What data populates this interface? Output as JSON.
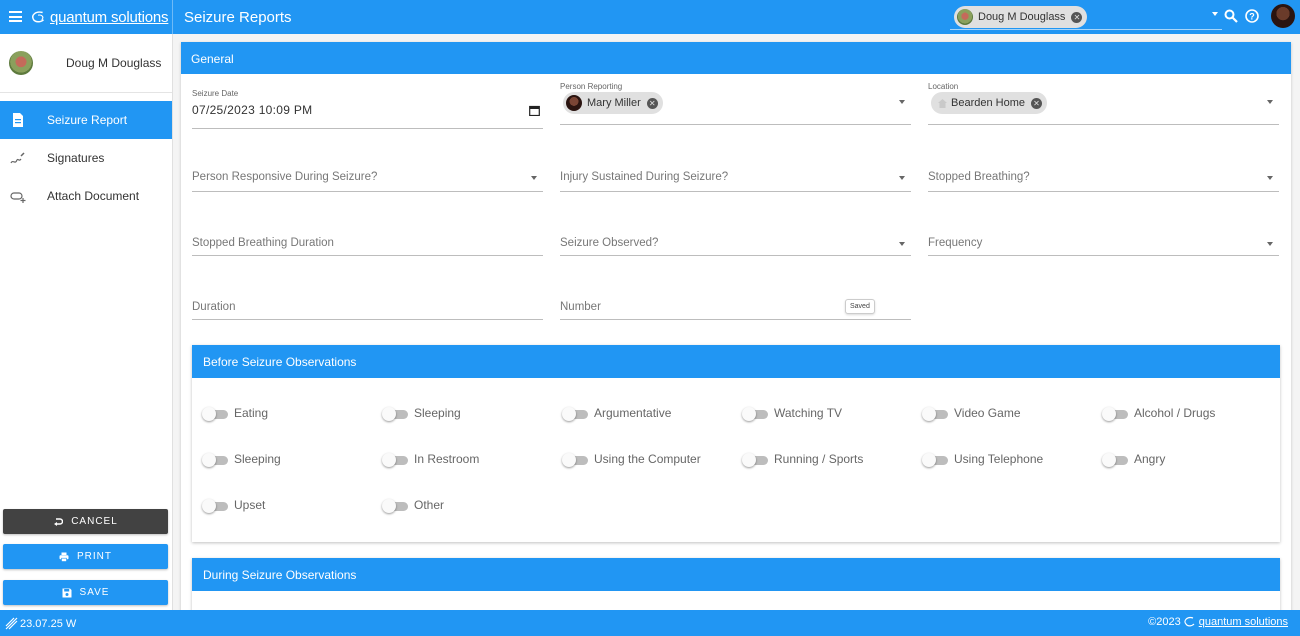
{
  "app": {
    "brand": "quantum solutions",
    "title": "Seizure Reports"
  },
  "header": {
    "selected_user": "Doug M Douglass"
  },
  "sidebar": {
    "user_name": "Doug M Douglass",
    "items": [
      {
        "label": "Seizure Report",
        "icon": "document-icon",
        "active": true
      },
      {
        "label": "Signatures",
        "icon": "signature-icon",
        "active": false
      },
      {
        "label": "Attach Document",
        "icon": "attach-icon",
        "active": false
      }
    ],
    "buttons": {
      "cancel": "CANCEL",
      "print": "PRINT",
      "save": "SAVE"
    }
  },
  "general": {
    "heading": "General",
    "seizure_date": {
      "label": "Seizure Date",
      "value": "07/25/2023 10:09 PM"
    },
    "person_reporting": {
      "label": "Person Reporting",
      "value": "Mary Miller"
    },
    "location": {
      "label": "Location",
      "value": "Bearden Home"
    },
    "responsive": {
      "label": "Person Responsive During Seizure?"
    },
    "injury": {
      "label": "Injury Sustained During Seizure?"
    },
    "stopped_breathing": {
      "label": "Stopped Breathing?"
    },
    "stopped_breathing_duration": {
      "label": "Stopped Breathing Duration"
    },
    "seizure_observed": {
      "label": "Seizure Observed?"
    },
    "frequency": {
      "label": "Frequency"
    },
    "duration": {
      "label": "Duration"
    },
    "number": {
      "label": "Number"
    },
    "saved_tooltip": "Saved"
  },
  "before": {
    "heading": "Before Seizure Observations",
    "options": [
      "Eating",
      "Sleeping",
      "Argumentative",
      "Watching TV",
      "Video Game",
      "Alcohol / Drugs",
      "Sleeping",
      "In Restroom",
      "Using the Computer",
      "Running / Sports",
      "Using Telephone",
      "Angry",
      "Upset",
      "Other"
    ]
  },
  "during": {
    "heading": "During Seizure Observations"
  },
  "footer": {
    "version": "23.07.25 W",
    "copyright_year": "©2023",
    "brand": "quantum solutions"
  },
  "colors": {
    "primary": "#2196f3",
    "dark_button": "#424242"
  }
}
